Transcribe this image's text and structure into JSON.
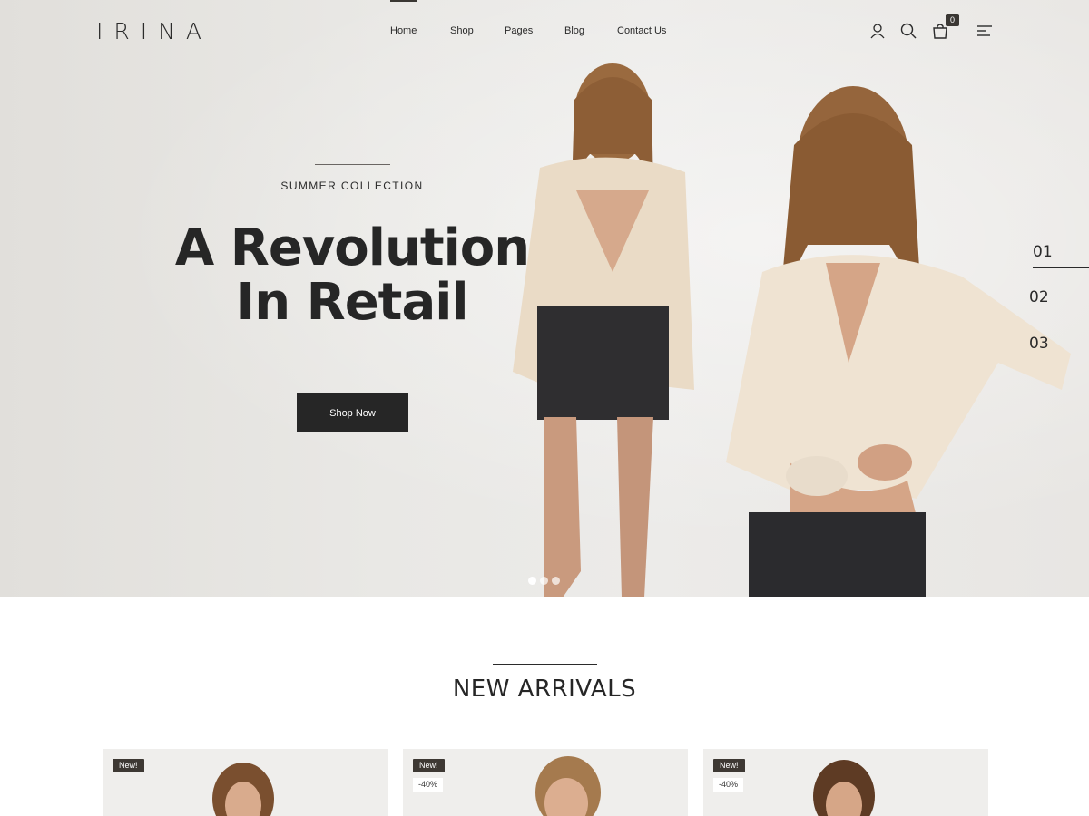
{
  "brand": {
    "logo": "IRINA"
  },
  "nav": {
    "items": [
      {
        "label": "Home",
        "active": true
      },
      {
        "label": "Shop"
      },
      {
        "label": "Pages"
      },
      {
        "label": "Blog"
      },
      {
        "label": "Contact Us"
      }
    ]
  },
  "header_icons": {
    "account": "user-icon",
    "search": "search-icon",
    "cart": "cart-icon",
    "menu": "menu-icon",
    "cart_count": "0"
  },
  "hero": {
    "subtitle": "SUMMER COLLECTION",
    "title_line1": "A Revolution",
    "title_line2": "In Retail",
    "cta": "Shop Now",
    "slides": [
      "01",
      "02",
      "03"
    ],
    "active_slide": 0
  },
  "new_arrivals": {
    "title": "NEW ARRIVALS",
    "products": [
      {
        "badge": "New!",
        "discount": ""
      },
      {
        "badge": "New!",
        "discount": "-40%"
      },
      {
        "badge": "New!",
        "discount": "-40%"
      }
    ]
  },
  "colors": {
    "primary_dark": "#262626",
    "badge_dark": "#3d3833",
    "hero_bg": "#e9e8e5"
  }
}
